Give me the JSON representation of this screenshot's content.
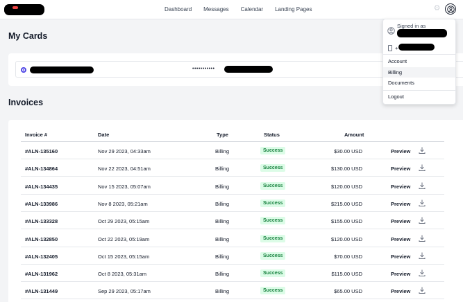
{
  "nav": {
    "items": [
      {
        "label": "Dashboard"
      },
      {
        "label": "Messages"
      },
      {
        "label": "Calendar"
      },
      {
        "label": "Landing Pages"
      }
    ]
  },
  "sections": {
    "cards_title": "My Cards",
    "invoices_title": "Invoices"
  },
  "card": {
    "mask": "•••••••••••"
  },
  "invoices": {
    "columns": [
      "Invoice #",
      "Date",
      "Type",
      "Status",
      "Amount"
    ],
    "rows": [
      {
        "invoice": "#ALN-135160",
        "date": "Nov 29 2023, 04:33am",
        "type": "Billing",
        "status": "Success",
        "amount": "$30.00 USD",
        "action": "Preview"
      },
      {
        "invoice": "#ALN-134864",
        "date": "Nov 22 2023, 04:51am",
        "type": "Billing",
        "status": "Success",
        "amount": "$130.00 USD",
        "action": "Preview"
      },
      {
        "invoice": "#ALN-134435",
        "date": "Nov 15 2023, 05:07am",
        "type": "Billing",
        "status": "Success",
        "amount": "$120.00 USD",
        "action": "Preview"
      },
      {
        "invoice": "#ALN-133986",
        "date": "Nov 8 2023, 05:21am",
        "type": "Billing",
        "status": "Success",
        "amount": "$215.00 USD",
        "action": "Preview"
      },
      {
        "invoice": "#ALN-133328",
        "date": "Oct 29 2023, 05:15am",
        "type": "Billing",
        "status": "Success",
        "amount": "$155.00 USD",
        "action": "Preview"
      },
      {
        "invoice": "#ALN-132850",
        "date": "Oct 22 2023, 05:19am",
        "type": "Billing",
        "status": "Success",
        "amount": "$120.00 USD",
        "action": "Preview"
      },
      {
        "invoice": "#ALN-132405",
        "date": "Oct 15 2023, 05:15am",
        "type": "Billing",
        "status": "Success",
        "amount": "$70.00 USD",
        "action": "Preview"
      },
      {
        "invoice": "#ALN-131962",
        "date": "Oct 8 2023, 05:31am",
        "type": "Billing",
        "status": "Success",
        "amount": "$115.00 USD",
        "action": "Preview"
      },
      {
        "invoice": "#ALN-131449",
        "date": "Sep 29 2023, 05:17am",
        "type": "Billing",
        "status": "Success",
        "amount": "$65.00 USD",
        "action": "Preview"
      }
    ]
  },
  "dropdown": {
    "signed_in_as": "Signed in as",
    "phone_prefix": "+",
    "items": [
      {
        "label": "Account"
      },
      {
        "label": "Billing"
      },
      {
        "label": "Documents"
      },
      {
        "label": "Logout"
      }
    ]
  },
  "colors": {
    "accent": "#4f46e5",
    "success_bg": "#dcfce7",
    "success_text": "#15803d"
  },
  "icons": {
    "settings": "gear-icon",
    "avatar": "user-circle-icon",
    "download": "download-icon",
    "phone": "phone-icon"
  }
}
